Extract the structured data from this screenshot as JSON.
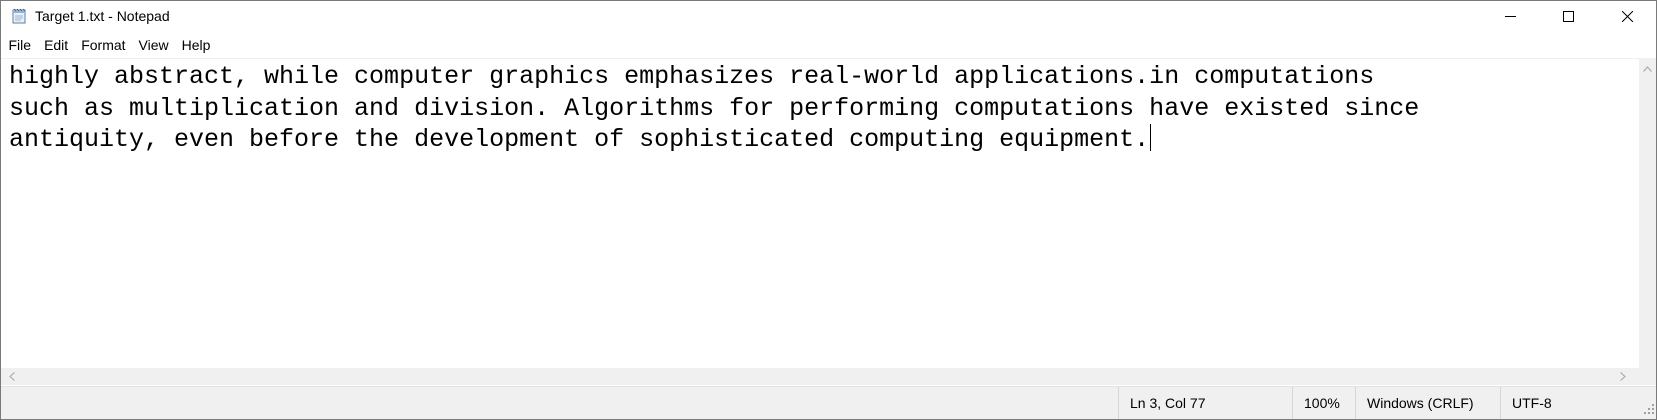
{
  "window": {
    "title": "Target 1.txt - Notepad",
    "app_icon": "notepad-icon",
    "controls": {
      "minimize_icon": "minimize-icon",
      "maximize_icon": "maximize-icon",
      "close_icon": "close-icon"
    }
  },
  "menu": {
    "items": [
      "File",
      "Edit",
      "Format",
      "View",
      "Help"
    ]
  },
  "editor": {
    "lines": [
      "highly abstract, while computer graphics emphasizes real-world applications.in computations",
      "such as multiplication and division. Algorithms for performing computations have existed since",
      "antiquity, even before the development of sophisticated computing equipment."
    ],
    "caret_line": 3,
    "caret_col": 77
  },
  "scrollbars": {
    "vertical_up_icon": "chevron-up-icon",
    "horizontal_left_icon": "chevron-left-icon",
    "horizontal_right_icon": "chevron-right-icon"
  },
  "statusbar": {
    "position": "Ln 3, Col 77",
    "zoom": "100%",
    "line_ending": "Windows (CRLF)",
    "encoding": "UTF-8"
  }
}
